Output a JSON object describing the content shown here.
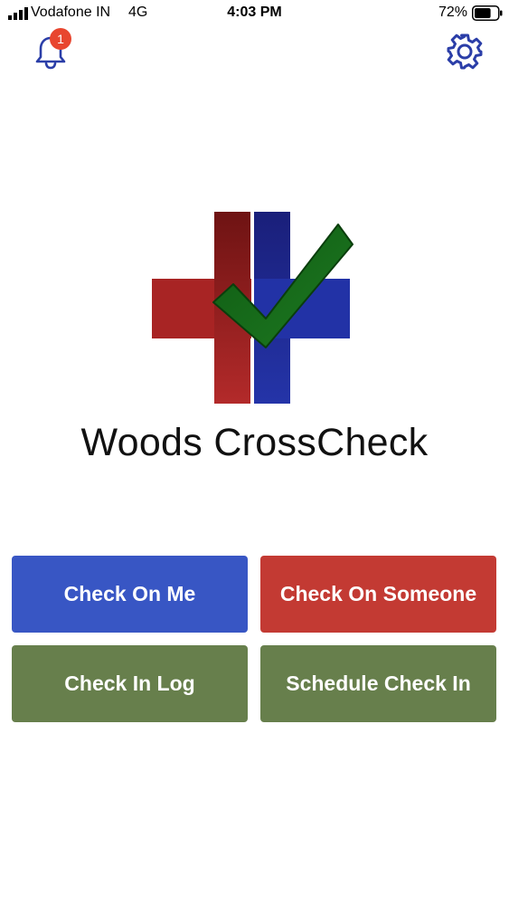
{
  "status_bar": {
    "carrier": "Vodafone IN",
    "network": "4G",
    "time": "4:03 PM",
    "battery_percent": "72%",
    "battery_level": 0.72
  },
  "header": {
    "notification_count": "1",
    "notification_icon": "bell-icon",
    "settings_icon": "gear-icon"
  },
  "app": {
    "title": "Woods CrossCheck"
  },
  "actions": {
    "check_on_me": "Check On Me",
    "check_on_someone": "Check On Someone",
    "check_in_log": "Check In Log",
    "schedule_check_in": "Schedule Check In"
  },
  "colors": {
    "blue_button": "#3856c4",
    "red_button": "#c33a33",
    "green_button": "#677f4c",
    "icon_blue": "#2b3ea8",
    "badge_red": "#e8462f"
  }
}
